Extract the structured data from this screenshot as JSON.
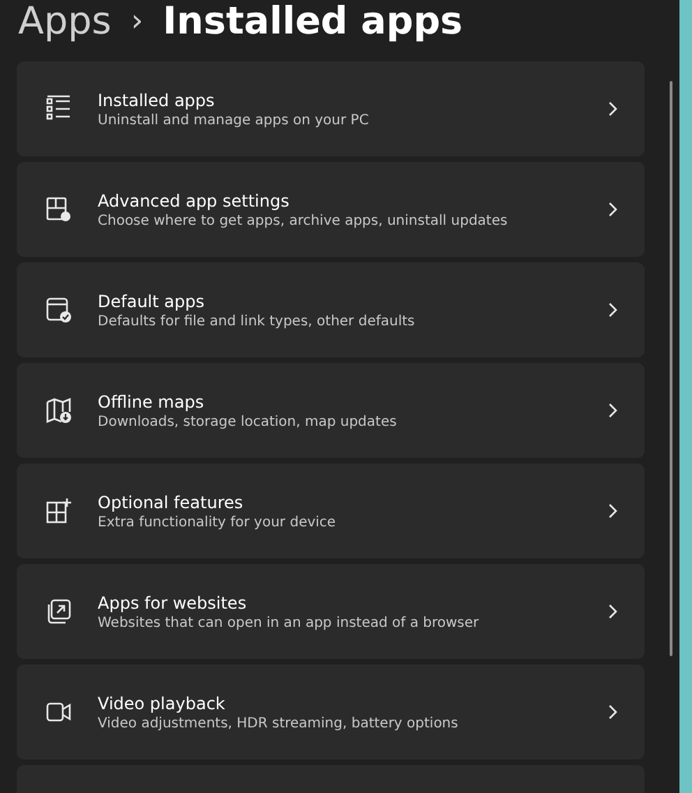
{
  "breadcrumb": {
    "parent": "Apps",
    "separator": "›",
    "current": "Installed apps"
  },
  "items": [
    {
      "title": "Installed apps",
      "description": "Uninstall and manage apps on your PC"
    },
    {
      "title": "Advanced app settings",
      "description": "Choose where to get apps, archive apps, uninstall updates"
    },
    {
      "title": "Default apps",
      "description": "Defaults for file and link types, other defaults"
    },
    {
      "title": "Offline maps",
      "description": "Downloads, storage location, map updates"
    },
    {
      "title": "Optional features",
      "description": "Extra functionality for your device"
    },
    {
      "title": "Apps for websites",
      "description": "Websites that can open in an app instead of a browser"
    },
    {
      "title": "Video playback",
      "description": "Video adjustments, HDR streaming, battery options"
    }
  ]
}
